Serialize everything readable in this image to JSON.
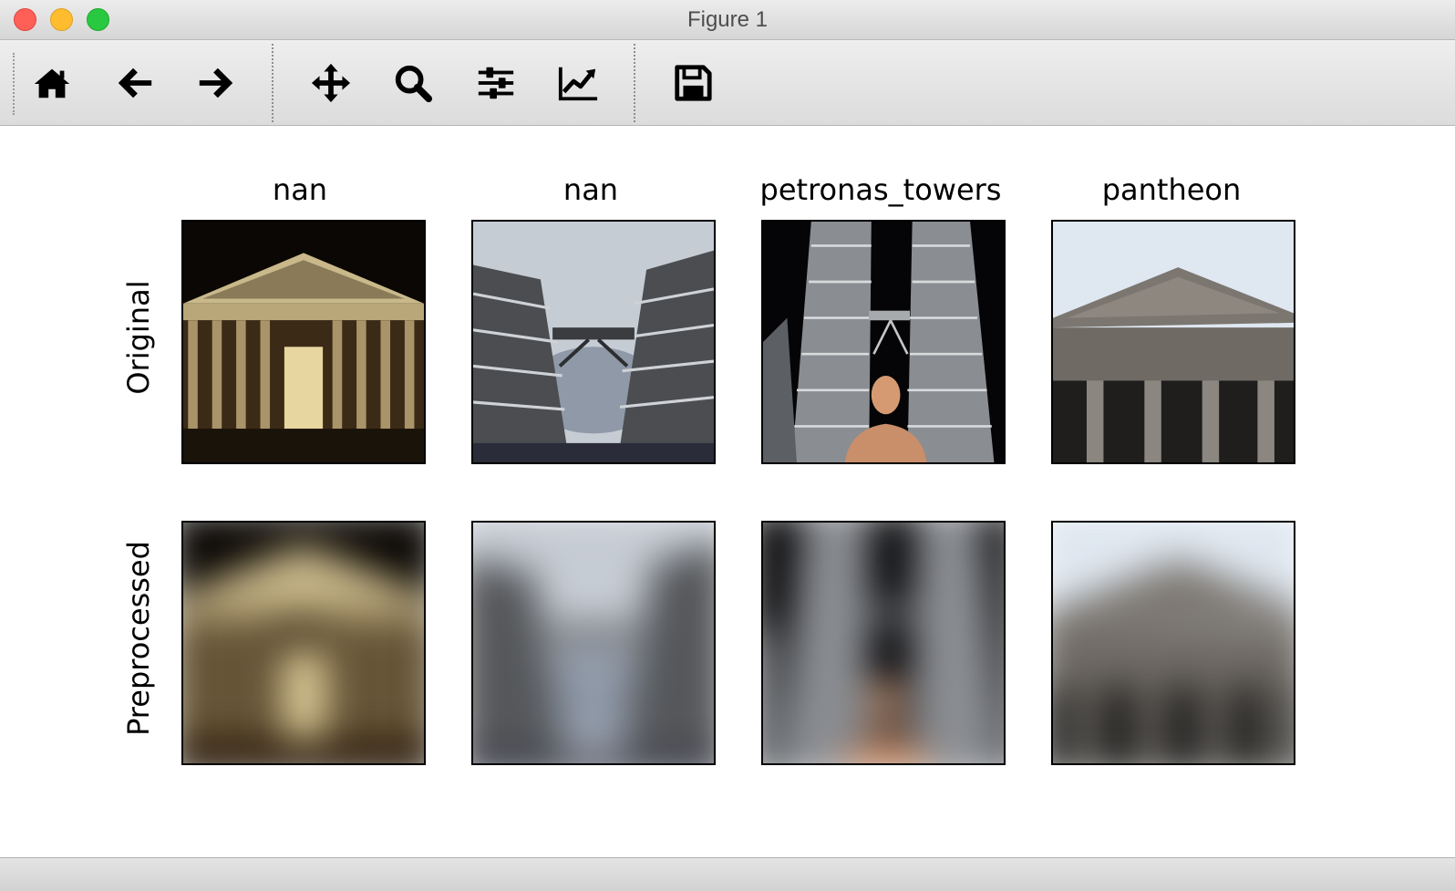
{
  "window": {
    "title": "Figure 1"
  },
  "toolbar": {
    "buttons": [
      {
        "name": "home-icon",
        "label": "Home"
      },
      {
        "name": "back-arrow-icon",
        "label": "Back"
      },
      {
        "name": "forward-arrow-icon",
        "label": "Forward"
      },
      {
        "name": "pan-move-icon",
        "label": "Pan"
      },
      {
        "name": "zoom-magnifier-icon",
        "label": "Zoom"
      },
      {
        "name": "configure-subplots-icon",
        "label": "Subplots"
      },
      {
        "name": "edit-axes-line-icon",
        "label": "Customize"
      },
      {
        "name": "save-floppy-icon",
        "label": "Save"
      }
    ]
  },
  "figure": {
    "columns": [
      {
        "title": "nan",
        "subject": "pantheon-night"
      },
      {
        "title": "nan",
        "subject": "petronas-towers-day"
      },
      {
        "title": "petronas_towers",
        "subject": "petronas-towers-night-with-person"
      },
      {
        "title": "pantheon",
        "subject": "pantheon-day"
      }
    ],
    "rows": [
      {
        "label": "Original",
        "style": "sharp"
      },
      {
        "label": "Preprocessed",
        "style": "blurred"
      }
    ]
  },
  "colors": {
    "close": "#fe5f57",
    "minimize": "#febc2e",
    "zoom": "#28c840"
  }
}
